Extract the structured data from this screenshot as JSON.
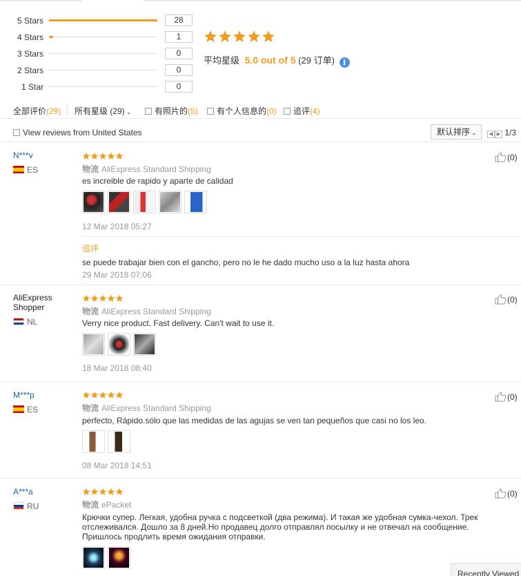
{
  "histogram": [
    {
      "label": "5 Stars",
      "count": "28",
      "fraction": 1.0
    },
    {
      "label": "4 Stars",
      "count": "1",
      "fraction": 0.036
    },
    {
      "label": "3 Stars",
      "count": "0",
      "fraction": 0
    },
    {
      "label": "2 Stars",
      "count": "0",
      "fraction": 0
    },
    {
      "label": "1 Star",
      "count": "0",
      "fraction": 0
    }
  ],
  "summary": {
    "stars": 5,
    "avg_label": "平均星级",
    "avg_value": "5.0 out of 5",
    "order_count": "(29 订单)",
    "info_glyph": "i"
  },
  "filters": {
    "all_label": "全部评价",
    "all_count": "(29)",
    "all_stars_label": "所有星级 (29)",
    "with_photos_label": "有照片的",
    "with_photos_count": "(5)",
    "personal_info_label": "有个人信息的",
    "personal_info_count": "(0)",
    "followup_label": "追评",
    "followup_count": "(4)"
  },
  "subbar": {
    "us_filter": "View reviews from United States",
    "sort_label": "默认排序",
    "page": "1/3"
  },
  "colors": {
    "accent": "#f29c1f",
    "link": "#1b5fa8",
    "muted": "#999999"
  },
  "reviews": [
    {
      "user": "N***v",
      "country": "ES",
      "stars": 5,
      "shipping_label": "物流",
      "shipping": "AliExpress Standard Shipping",
      "text": "es increible de rapido y aparte de calidad",
      "photos": 5,
      "date": "12 Mar 2018 05:27",
      "followup_title": "追评",
      "followup_text": "se puede trabajar bien con el gancho, pero no le he dado mucho uso a la luz hasta ahora",
      "followup_date": "29 Mar 2018 07:06",
      "likes": "(0)"
    },
    {
      "user_line1": "AliExpress",
      "user_line2": "Shopper",
      "country": "NL",
      "stars": 5,
      "shipping_label": "物流",
      "shipping": "AliExpress Standard Shipping",
      "text": "Verry nice product. Fast delivery. Can't wait to use it.",
      "photos": 3,
      "date": "18 Mar 2018 08:40",
      "likes": "(0)"
    },
    {
      "user": "M***p",
      "country": "ES",
      "stars": 5,
      "shipping_label": "物流",
      "shipping": "AliExpress Standard Shipping",
      "text": "perfecto, Rápido.sólo que las medidas de las agujas se ven tan pequeños que casi no los leo.",
      "photos": 2,
      "date": "08 Mar 2018 14:51",
      "likes": "(0)"
    },
    {
      "user": "A***a",
      "country": "RU",
      "stars": 5,
      "shipping_label": "物流",
      "shipping": "ePacket",
      "text": "Крючки супер. Легкая, удобна ручка с подсветкой (два режима). И такая же удобная сумка-чехол. Трек отслеживался. Дошло за 8 дней.Но продавец долго отправлял посылку и не отвечал на сообщение. Пришлось продлить время ожидания отправки.",
      "photos": 2,
      "likes": "(0)"
    }
  ],
  "recently_viewed": "Recently Viewed"
}
